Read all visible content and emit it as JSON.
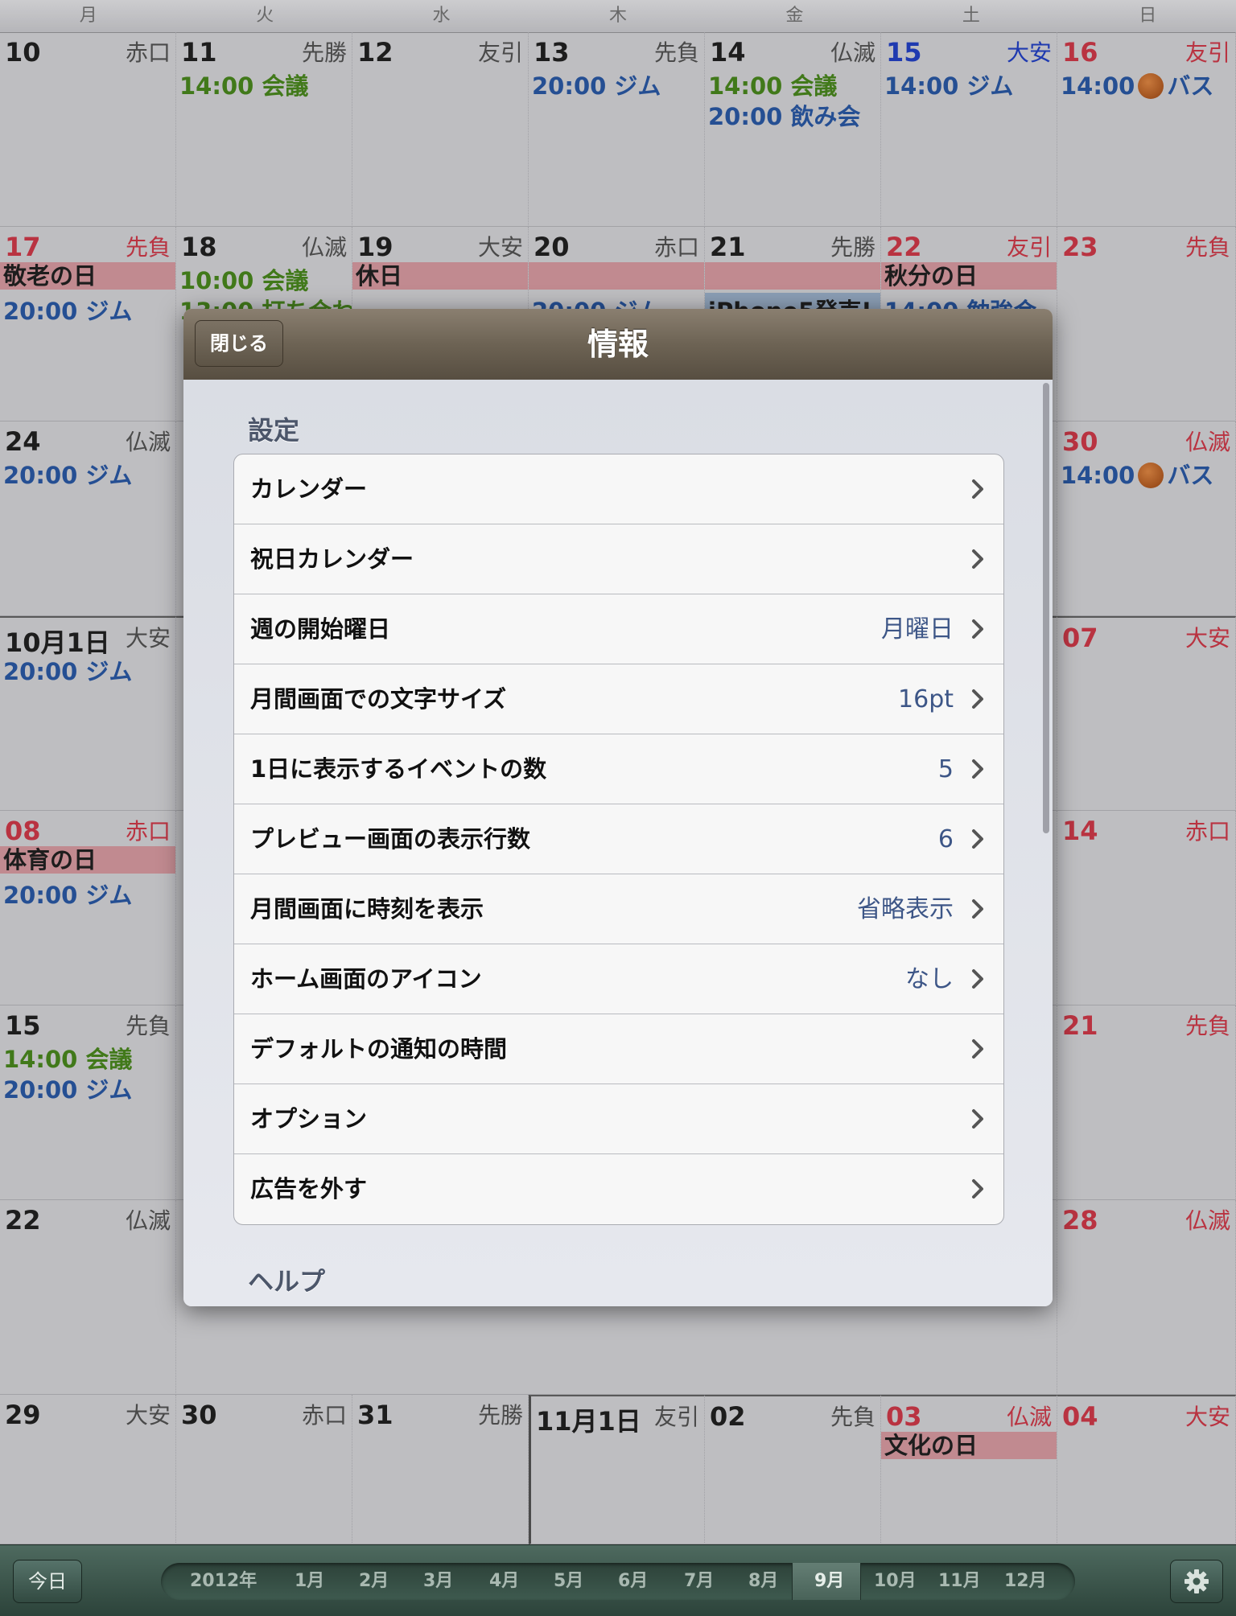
{
  "weekdays": [
    "月",
    "火",
    "水",
    "木",
    "金",
    "土",
    "日"
  ],
  "calendar": {
    "week1": {
      "mon": {
        "day": "10",
        "rokuyo": "赤口"
      },
      "tue": {
        "day": "11",
        "rokuyo": "先勝",
        "ev1_time": "14:00",
        "ev1_title": "会議"
      },
      "wed": {
        "day": "12",
        "rokuyo": "友引"
      },
      "thu": {
        "day": "13",
        "rokuyo": "先負",
        "ev1_time": "20:00",
        "ev1_title": "ジム"
      },
      "fri": {
        "day": "14",
        "rokuyo": "仏滅",
        "ev1_time": "14:00",
        "ev1_title": "会議",
        "ev2_time": "20:00",
        "ev2_title": "飲み会"
      },
      "sat": {
        "day": "15",
        "rokuyo": "大安",
        "ev1_time": "14:00",
        "ev1_title": "ジム"
      },
      "sun": {
        "day": "16",
        "rokuyo": "友引",
        "ev1_time": "14:00",
        "ev1_title": "バス"
      }
    },
    "week2": {
      "mon": {
        "day": "17",
        "rokuyo": "先負",
        "holiday": "敬老の日",
        "ev1_time": "20:00",
        "ev1_title": "ジム"
      },
      "tue": {
        "day": "18",
        "rokuyo": "仏滅",
        "ev1_time": "10:00",
        "ev1_title": "会議",
        "ev2_partial": "13:00 打ち合わ"
      },
      "wed": {
        "day": "19",
        "rokuyo": "大安",
        "holiday": "休日"
      },
      "thu": {
        "day": "20",
        "rokuyo": "赤口",
        "ev_partial": "20:00 ジム"
      },
      "fri": {
        "day": "21",
        "rokuyo": "先勝",
        "ev_partial": "iPhone5発売!"
      },
      "sat": {
        "day": "22",
        "rokuyo": "友引",
        "holiday": "秋分の日",
        "ev_partial": "14:00 勉強会"
      },
      "sun": {
        "day": "23",
        "rokuyo": "先負"
      }
    },
    "week3": {
      "mon": {
        "day": "24",
        "rokuyo": "仏滅",
        "ev1_time": "20:00",
        "ev1_title": "ジム"
      },
      "sun": {
        "day": "30",
        "rokuyo": "仏滅",
        "ev1_time": "14:00",
        "ev1_title": "バス"
      }
    },
    "week4": {
      "mon": {
        "day": "10月1日",
        "rokuyo": "大安",
        "ev1_time": "20:00",
        "ev1_title": "ジム"
      },
      "sun": {
        "day": "07",
        "rokuyo": "大安"
      }
    },
    "week5": {
      "mon": {
        "day": "08",
        "rokuyo": "赤口",
        "holiday": "体育の日",
        "ev1_time": "20:00",
        "ev1_title": "ジム"
      },
      "sun": {
        "day": "14",
        "rokuyo": "赤口"
      }
    },
    "week6": {
      "mon": {
        "day": "15",
        "rokuyo": "先負",
        "ev1_time": "14:00",
        "ev1_title": "会議",
        "ev2_time": "20:00",
        "ev2_title": "ジム"
      },
      "sun": {
        "day": "21",
        "rokuyo": "先負"
      }
    },
    "week7": {
      "mon": {
        "day": "22",
        "rokuyo": "仏滅"
      },
      "sun": {
        "day": "28",
        "rokuyo": "仏滅"
      }
    },
    "week8": {
      "mon": {
        "day": "29",
        "rokuyo": "大安"
      },
      "tue": {
        "day": "30",
        "rokuyo": "赤口"
      },
      "wed": {
        "day": "31",
        "rokuyo": "先勝"
      },
      "thu": {
        "day": "11月1日",
        "rokuyo": "友引"
      },
      "fri": {
        "day": "02",
        "rokuyo": "先負"
      },
      "sat": {
        "day": "03",
        "rokuyo": "仏滅",
        "holiday": "文化の日"
      },
      "sun": {
        "day": "04",
        "rokuyo": "大安"
      }
    }
  },
  "modal": {
    "title": "情報",
    "close_label": "閉じる",
    "section_settings": "設定",
    "section_help": "ヘルプ",
    "rows": [
      {
        "label": "カレンダー",
        "value": ""
      },
      {
        "label": "祝日カレンダー",
        "value": ""
      },
      {
        "label": "週の開始曜日",
        "value": "月曜日"
      },
      {
        "label": "月間画面での文字サイズ",
        "value": "16pt"
      },
      {
        "label": "1日に表示するイベントの数",
        "value": "5"
      },
      {
        "label": "プレビュー画面の表示行数",
        "value": "6"
      },
      {
        "label": "月間画面に時刻を表示",
        "value": "省略表示"
      },
      {
        "label": "ホーム画面のアイコン",
        "value": "なし"
      },
      {
        "label": "デフォルトの通知の時間",
        "value": ""
      },
      {
        "label": "オプション",
        "value": ""
      },
      {
        "label": "広告を外す",
        "value": ""
      }
    ]
  },
  "toolbar": {
    "today_label": "今日",
    "year_label": "2012年",
    "months": [
      "1月",
      "2月",
      "3月",
      "4月",
      "5月",
      "6月",
      "7月",
      "8月",
      "9月",
      "10月",
      "11月",
      "12月"
    ],
    "selected_month": "9月",
    "settings_icon": "gear-icon"
  },
  "colors": {
    "sunday_red": "#d33b4a",
    "saturday_blue": "#2443c9",
    "event_green": "#4a8a1e",
    "event_blue": "#2b5aa8",
    "holiday_pink": "#dc9ea4",
    "nav_brown": "#6d6354",
    "toolbar_green": "#3e5a4f"
  }
}
